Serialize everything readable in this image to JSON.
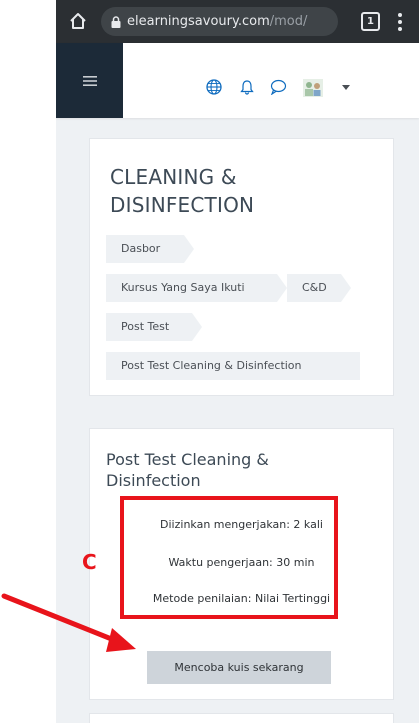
{
  "browser": {
    "url_domain": "elearningsavoury.com",
    "url_path": "/mod/",
    "tab_count": "1"
  },
  "page": {
    "title": "CLEANING & DISINFECTION",
    "breadcrumbs": [
      "Dasbor",
      "Kursus Yang Saya Ikuti",
      "C&D",
      "Post Test",
      "Post Test Cleaning & Disinfection"
    ]
  },
  "quiz": {
    "title": "Post Test Cleaning & Disinfection",
    "info": [
      "Diizinkan mengerjakan: 2 kali",
      "Waktu pengerjaan: 30 min",
      "Metode penilaian: Nilai Tertinggi"
    ],
    "attempt_button": "Mencoba kuis sekarang"
  },
  "annotation": {
    "label": "C",
    "color": "#e8141b"
  },
  "colors": {
    "chrome_bar": "#2b2f33",
    "navbar_dark": "#1c2a38",
    "page_bg": "#eef1f4",
    "nav_accent": "#0f6cbf"
  }
}
